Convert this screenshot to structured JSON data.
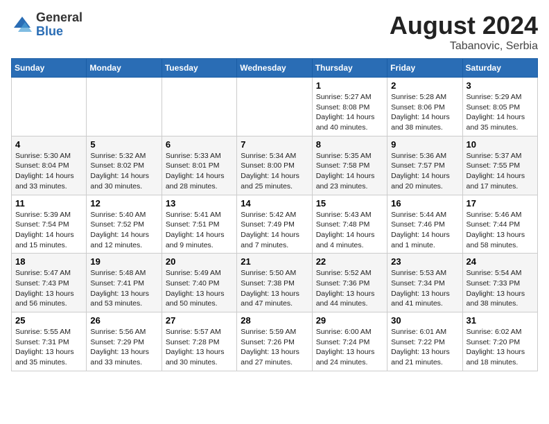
{
  "header": {
    "logo_line1": "General",
    "logo_line2": "Blue",
    "title": "August 2024",
    "location": "Tabanovic, Serbia"
  },
  "days_of_week": [
    "Sunday",
    "Monday",
    "Tuesday",
    "Wednesday",
    "Thursday",
    "Friday",
    "Saturday"
  ],
  "weeks": [
    [
      {
        "day": "",
        "info": ""
      },
      {
        "day": "",
        "info": ""
      },
      {
        "day": "",
        "info": ""
      },
      {
        "day": "",
        "info": ""
      },
      {
        "day": "1",
        "info": "Sunrise: 5:27 AM\nSunset: 8:08 PM\nDaylight: 14 hours\nand 40 minutes."
      },
      {
        "day": "2",
        "info": "Sunrise: 5:28 AM\nSunset: 8:06 PM\nDaylight: 14 hours\nand 38 minutes."
      },
      {
        "day": "3",
        "info": "Sunrise: 5:29 AM\nSunset: 8:05 PM\nDaylight: 14 hours\nand 35 minutes."
      }
    ],
    [
      {
        "day": "4",
        "info": "Sunrise: 5:30 AM\nSunset: 8:04 PM\nDaylight: 14 hours\nand 33 minutes."
      },
      {
        "day": "5",
        "info": "Sunrise: 5:32 AM\nSunset: 8:02 PM\nDaylight: 14 hours\nand 30 minutes."
      },
      {
        "day": "6",
        "info": "Sunrise: 5:33 AM\nSunset: 8:01 PM\nDaylight: 14 hours\nand 28 minutes."
      },
      {
        "day": "7",
        "info": "Sunrise: 5:34 AM\nSunset: 8:00 PM\nDaylight: 14 hours\nand 25 minutes."
      },
      {
        "day": "8",
        "info": "Sunrise: 5:35 AM\nSunset: 7:58 PM\nDaylight: 14 hours\nand 23 minutes."
      },
      {
        "day": "9",
        "info": "Sunrise: 5:36 AM\nSunset: 7:57 PM\nDaylight: 14 hours\nand 20 minutes."
      },
      {
        "day": "10",
        "info": "Sunrise: 5:37 AM\nSunset: 7:55 PM\nDaylight: 14 hours\nand 17 minutes."
      }
    ],
    [
      {
        "day": "11",
        "info": "Sunrise: 5:39 AM\nSunset: 7:54 PM\nDaylight: 14 hours\nand 15 minutes."
      },
      {
        "day": "12",
        "info": "Sunrise: 5:40 AM\nSunset: 7:52 PM\nDaylight: 14 hours\nand 12 minutes."
      },
      {
        "day": "13",
        "info": "Sunrise: 5:41 AM\nSunset: 7:51 PM\nDaylight: 14 hours\nand 9 minutes."
      },
      {
        "day": "14",
        "info": "Sunrise: 5:42 AM\nSunset: 7:49 PM\nDaylight: 14 hours\nand 7 minutes."
      },
      {
        "day": "15",
        "info": "Sunrise: 5:43 AM\nSunset: 7:48 PM\nDaylight: 14 hours\nand 4 minutes."
      },
      {
        "day": "16",
        "info": "Sunrise: 5:44 AM\nSunset: 7:46 PM\nDaylight: 14 hours\nand 1 minute."
      },
      {
        "day": "17",
        "info": "Sunrise: 5:46 AM\nSunset: 7:44 PM\nDaylight: 13 hours\nand 58 minutes."
      }
    ],
    [
      {
        "day": "18",
        "info": "Sunrise: 5:47 AM\nSunset: 7:43 PM\nDaylight: 13 hours\nand 56 minutes."
      },
      {
        "day": "19",
        "info": "Sunrise: 5:48 AM\nSunset: 7:41 PM\nDaylight: 13 hours\nand 53 minutes."
      },
      {
        "day": "20",
        "info": "Sunrise: 5:49 AM\nSunset: 7:40 PM\nDaylight: 13 hours\nand 50 minutes."
      },
      {
        "day": "21",
        "info": "Sunrise: 5:50 AM\nSunset: 7:38 PM\nDaylight: 13 hours\nand 47 minutes."
      },
      {
        "day": "22",
        "info": "Sunrise: 5:52 AM\nSunset: 7:36 PM\nDaylight: 13 hours\nand 44 minutes."
      },
      {
        "day": "23",
        "info": "Sunrise: 5:53 AM\nSunset: 7:34 PM\nDaylight: 13 hours\nand 41 minutes."
      },
      {
        "day": "24",
        "info": "Sunrise: 5:54 AM\nSunset: 7:33 PM\nDaylight: 13 hours\nand 38 minutes."
      }
    ],
    [
      {
        "day": "25",
        "info": "Sunrise: 5:55 AM\nSunset: 7:31 PM\nDaylight: 13 hours\nand 35 minutes."
      },
      {
        "day": "26",
        "info": "Sunrise: 5:56 AM\nSunset: 7:29 PM\nDaylight: 13 hours\nand 33 minutes."
      },
      {
        "day": "27",
        "info": "Sunrise: 5:57 AM\nSunset: 7:28 PM\nDaylight: 13 hours\nand 30 minutes."
      },
      {
        "day": "28",
        "info": "Sunrise: 5:59 AM\nSunset: 7:26 PM\nDaylight: 13 hours\nand 27 minutes."
      },
      {
        "day": "29",
        "info": "Sunrise: 6:00 AM\nSunset: 7:24 PM\nDaylight: 13 hours\nand 24 minutes."
      },
      {
        "day": "30",
        "info": "Sunrise: 6:01 AM\nSunset: 7:22 PM\nDaylight: 13 hours\nand 21 minutes."
      },
      {
        "day": "31",
        "info": "Sunrise: 6:02 AM\nSunset: 7:20 PM\nDaylight: 13 hours\nand 18 minutes."
      }
    ]
  ]
}
